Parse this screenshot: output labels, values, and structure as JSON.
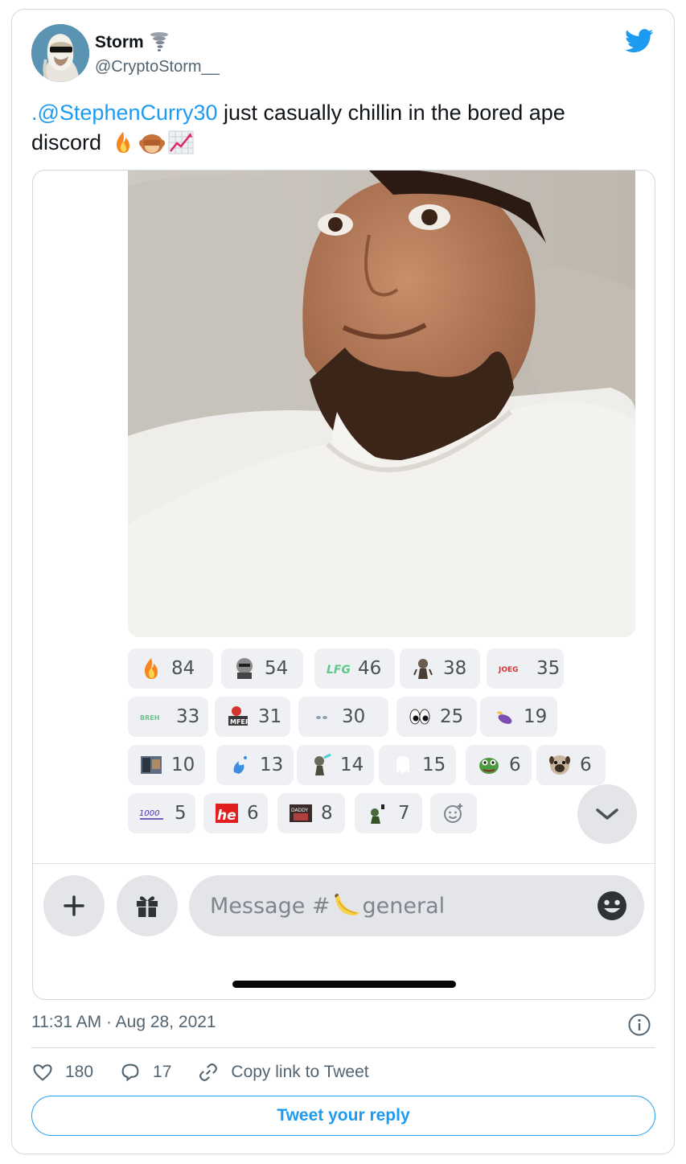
{
  "tweet": {
    "display_name": "Storm",
    "handle": "@CryptoStorm__",
    "mention": ".@StephenCurry30",
    "text_line1": " just casually chillin in the bored ape",
    "text_line2": "discord",
    "timestamp": "11:31 AM · Aug 28, 2021",
    "likes": "180",
    "replies": "17",
    "copy_link_label": "Copy link to Tweet",
    "reply_button_label": "Tweet your reply"
  },
  "discord": {
    "reactions": [
      {
        "icon": "fire-emoji",
        "count": "84"
      },
      {
        "icon": "ape-sticker-emoji",
        "count": "54"
      },
      {
        "icon": "lfg-emoji",
        "count": "46"
      },
      {
        "icon": "ape-figure-emoji",
        "count": "38"
      },
      {
        "icon": "joeg-emoji",
        "count": "35"
      },
      {
        "icon": "breh-emoji",
        "count": "33"
      },
      {
        "icon": "mfer-emoji",
        "count": "31"
      },
      {
        "icon": "small-eyes-emoji",
        "count": "30"
      },
      {
        "icon": "eyes-emoji",
        "count": "25"
      },
      {
        "icon": "eggplant-emoji",
        "count": "19"
      },
      {
        "icon": "meme-photo-emoji",
        "count": "10"
      },
      {
        "icon": "splash-emoji",
        "count": "13"
      },
      {
        "icon": "ape-zap-emoji",
        "count": "14"
      },
      {
        "icon": "ghost-emoji",
        "count": "15"
      },
      {
        "icon": "pepe-emoji",
        "count": "6"
      },
      {
        "icon": "pug-emoji",
        "count": "6"
      },
      {
        "icon": "hundred-emoji",
        "count": "5"
      },
      {
        "icon": "he-emoji",
        "count": "6"
      },
      {
        "icon": "daddy-emoji",
        "count": "8"
      },
      {
        "icon": "ape-drink-emoji",
        "count": "7"
      }
    ],
    "message_placeholder_prefix": "Message #",
    "message_placeholder_channel": "general"
  },
  "colors": {
    "accent": "#1d9bf0",
    "muted": "#536471",
    "discord_chip": "#eef0f3",
    "discord_input": "#e3e5e8"
  }
}
